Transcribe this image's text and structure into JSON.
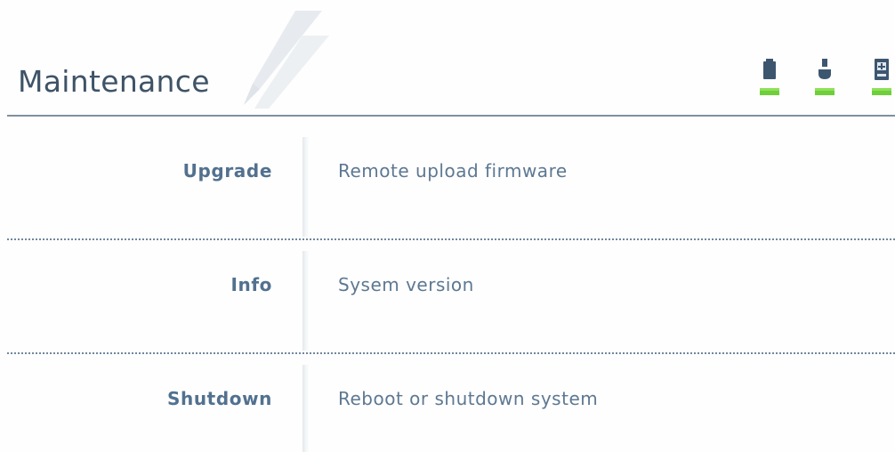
{
  "header": {
    "title": "Maintenance",
    "watermark_icon": "pen-icon",
    "status_icons": [
      {
        "name": "battery-icon",
        "indicator_color": "#6fcf3a"
      },
      {
        "name": "usb-icon",
        "indicator_color": "#6fcf3a"
      },
      {
        "name": "drive-icon",
        "indicator_color": "#6fcf3a"
      }
    ]
  },
  "menu": {
    "items": [
      {
        "label": "Upgrade",
        "description": "Remote upload firmware"
      },
      {
        "label": "Info",
        "description": "Sysem version"
      },
      {
        "label": "Shutdown",
        "description": "Reboot or shutdown system"
      }
    ]
  },
  "colors": {
    "title": "#3e5367",
    "label": "#52718f",
    "description": "#5d7892",
    "rule": "#7f90a0",
    "status_ok": "#6fcf3a",
    "icon_dark": "#3d5670"
  }
}
